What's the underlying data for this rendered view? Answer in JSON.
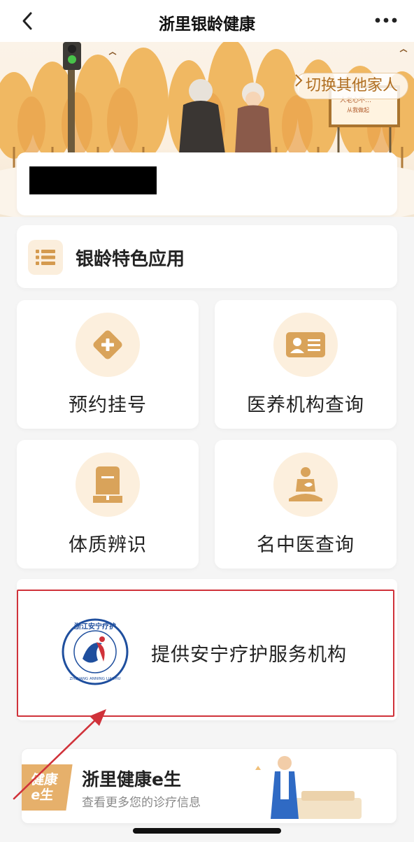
{
  "nav": {
    "title": "浙里银龄健康"
  },
  "banner": {
    "switch_label": "切换其他家人",
    "billboard_line1": "人老心不…",
    "billboard_line2": "从我做起"
  },
  "section": {
    "title": "银龄特色应用"
  },
  "tiles": [
    {
      "label": "预约挂号",
      "icon": "plus-diamond-icon"
    },
    {
      "label": "医养机构查询",
      "icon": "id-card-icon"
    },
    {
      "label": "体质辨识",
      "icon": "constitution-icon"
    },
    {
      "label": "名中医查询",
      "icon": "meditation-icon"
    }
  ],
  "anning": {
    "text": "提供安宁疗护服务机构",
    "logo_top": "浙江安宁疗护",
    "logo_bottom": "ZHEJIANG ANNING LIAOHU"
  },
  "health": {
    "badge_line1": "健康",
    "badge_line2": "e生",
    "title": "浙里健康e生",
    "subtitle": "查看更多您的诊疗信息"
  },
  "colors": {
    "accent": "#d49a4e",
    "highlight": "#d0323a",
    "tile_bg": "#fcefdd"
  }
}
